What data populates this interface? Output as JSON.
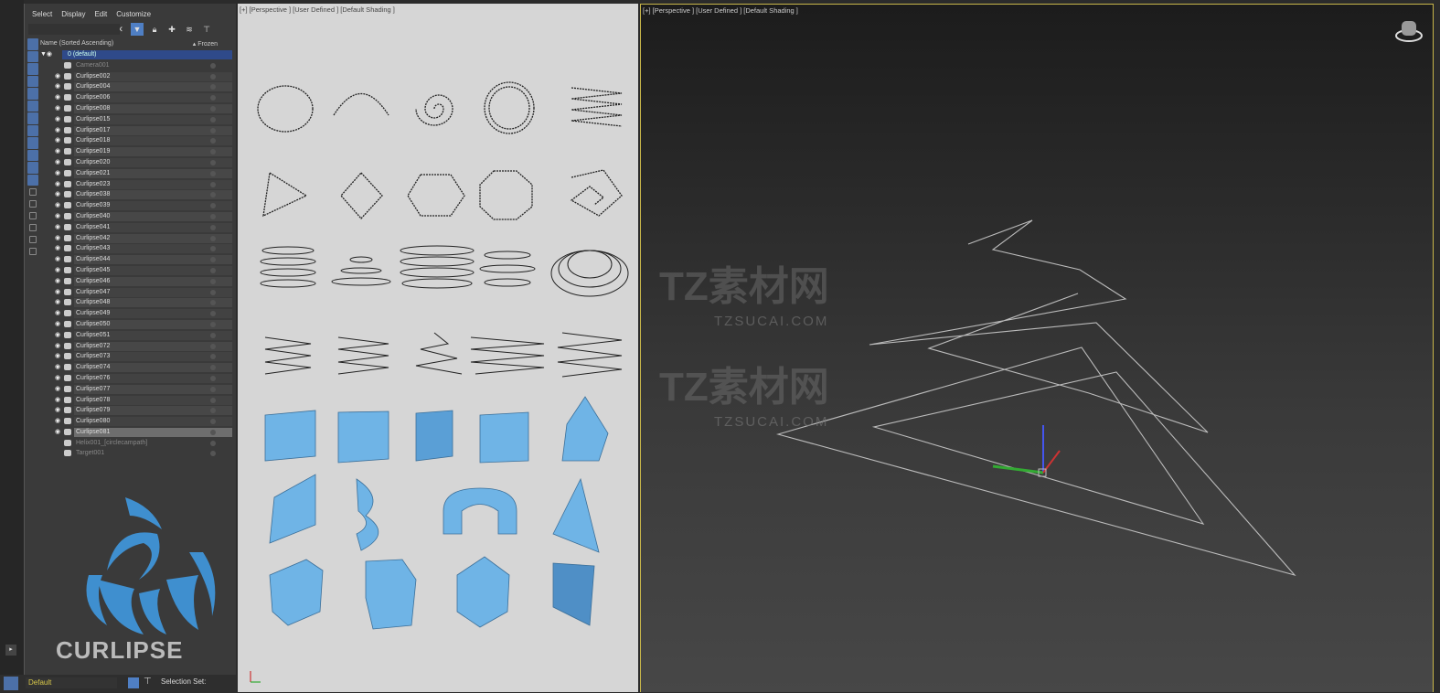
{
  "explorer": {
    "menu": [
      "Select",
      "Display",
      "Edit",
      "Customize"
    ],
    "header_name": "Name (Sorted Ascending)",
    "header_frozen": "▴ Frozen",
    "layer_root": "0 (default)",
    "items": [
      {
        "name": "Camera001",
        "type": "camera",
        "dim": true
      },
      {
        "name": "Curlipse002"
      },
      {
        "name": "Curlipse004"
      },
      {
        "name": "Curlipse006"
      },
      {
        "name": "Curlipse008"
      },
      {
        "name": "Curlipse015"
      },
      {
        "name": "Curlipse017"
      },
      {
        "name": "Curlipse018"
      },
      {
        "name": "Curlipse019"
      },
      {
        "name": "Curlipse020"
      },
      {
        "name": "Curlipse021"
      },
      {
        "name": "Curlipse023"
      },
      {
        "name": "Curlipse038"
      },
      {
        "name": "Curlipse039"
      },
      {
        "name": "Curlipse040"
      },
      {
        "name": "Curlipse041"
      },
      {
        "name": "Curlipse042"
      },
      {
        "name": "Curlipse043"
      },
      {
        "name": "Curlipse044"
      },
      {
        "name": "Curlipse045"
      },
      {
        "name": "Curlipse046"
      },
      {
        "name": "Curlipse047"
      },
      {
        "name": "Curlipse048"
      },
      {
        "name": "Curlipse049"
      },
      {
        "name": "Curlipse050"
      },
      {
        "name": "Curlipse051"
      },
      {
        "name": "Curlipse072"
      },
      {
        "name": "Curlipse073"
      },
      {
        "name": "Curlipse074"
      },
      {
        "name": "Curlipse076"
      },
      {
        "name": "Curlipse077"
      },
      {
        "name": "Curlipse078"
      },
      {
        "name": "Curlipse079"
      },
      {
        "name": "Curlipse080"
      },
      {
        "name": "Curlipse081",
        "selected": true
      },
      {
        "name": "Helix001_[circlecampath]",
        "dim": true
      },
      {
        "name": "Target001",
        "type": "camera",
        "dim": true
      }
    ],
    "logo_text": "CURLIPSE",
    "layer_value": "Default",
    "selection_set_label": "Selection Set:"
  },
  "viewports": [
    {
      "label": "[+] [Perspective ] [User Defined ] [Default Shading ]"
    },
    {
      "label": "[+] [Perspective ] [User Defined ] [Default Shading ]"
    }
  ],
  "watermark": {
    "brand": "TZ素材网",
    "url": "TZSUCAI.COM"
  },
  "colors": {
    "accent": "#4f7fc4",
    "object_blue": "#6fb4e6",
    "viewport_border": "#c8b64a"
  }
}
